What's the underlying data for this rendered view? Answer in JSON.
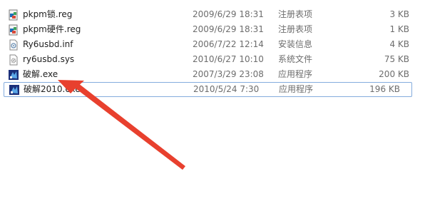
{
  "files": [
    {
      "name": "pkpm锁.reg",
      "date": "2009/6/29 18:31",
      "type": "注册表项",
      "size": "3 KB",
      "icon": "registry-file-icon"
    },
    {
      "name": "pkpm硬件.reg",
      "date": "2009/6/29 18:31",
      "type": "注册表项",
      "size": "1 KB",
      "icon": "registry-file-icon"
    },
    {
      "name": "Ry6usbd.inf",
      "date": "2006/7/22 12:14",
      "type": "安装信息",
      "size": "4 KB",
      "icon": "setup-info-file-icon"
    },
    {
      "name": "ry6usbd.sys",
      "date": "2010/6/27 10:10",
      "type": "系统文件",
      "size": "75 KB",
      "icon": "system-file-icon"
    },
    {
      "name": "破解.exe",
      "date": "2007/3/29 23:08",
      "type": "应用程序",
      "size": "200 KB",
      "icon": "application-icon"
    },
    {
      "name": "破解2010.exe",
      "date": "2010/5/24 7:30",
      "type": "应用程序",
      "size": "196 KB",
      "icon": "application-icon"
    }
  ],
  "annotation": {
    "color": "#e8402e"
  }
}
